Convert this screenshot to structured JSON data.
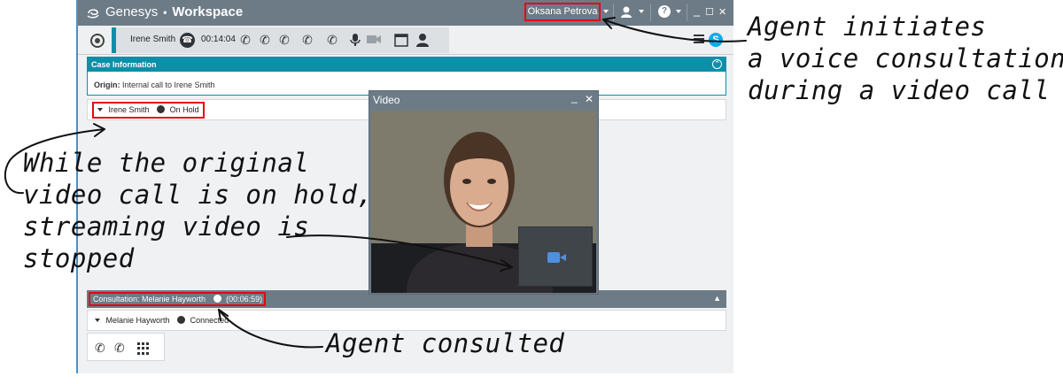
{
  "window": {
    "brand": "Genesys",
    "separator": "•",
    "product": "Workspace",
    "user_name": "Oksana Petrova",
    "help_icon": "?",
    "minimize": "_",
    "maximize": "☐",
    "close": "✕"
  },
  "toolbar": {
    "party_name": "Irene Smith",
    "timer": "00:14:04",
    "skype_label": "S"
  },
  "case": {
    "header": "Case Information",
    "origin_label": "Origin:",
    "origin_value": "Internal call to Irene Smith"
  },
  "party": {
    "name": "Irene Smith",
    "status": "On Hold"
  },
  "video": {
    "title": "Video",
    "minimize": "_",
    "close": "✕"
  },
  "consultation": {
    "label": "Consultation: Melanie Hayworth",
    "duration": "(00:06:59)",
    "party_name": "Melanie Hayworth",
    "party_status": "Connected"
  },
  "annotations": {
    "top_right": [
      "Agent initiates",
      "a voice consultation",
      "during a video call"
    ],
    "left": [
      "While the original",
      "video call is on hold,",
      "streaming video is",
      "stopped"
    ],
    "bottom": "Agent consulted"
  },
  "colors": {
    "titlebar": "#6d7b87",
    "accent": "#0d8fa8",
    "highlight": "#e30613",
    "camera": "#4e8fe0"
  }
}
